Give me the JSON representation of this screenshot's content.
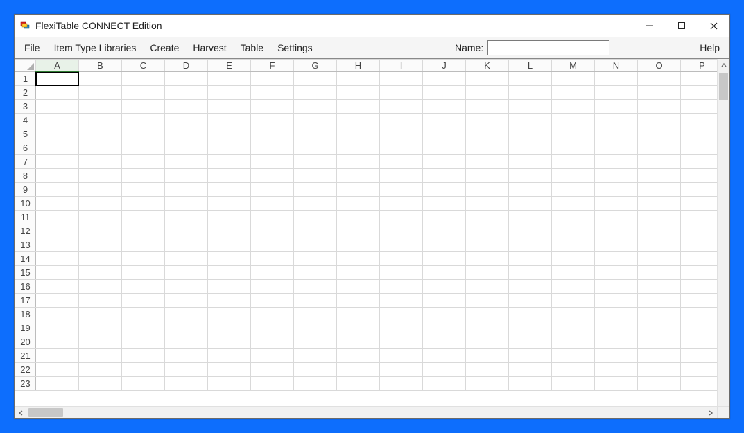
{
  "window": {
    "title": "FlexiTable CONNECT Edition"
  },
  "menubar": {
    "items": [
      "File",
      "Item Type Libraries",
      "Create",
      "Harvest",
      "Table",
      "Settings"
    ],
    "name_label": "Name:",
    "name_value": "",
    "help": "Help"
  },
  "sheet": {
    "columns": [
      "A",
      "B",
      "C",
      "D",
      "E",
      "F",
      "G",
      "H",
      "I",
      "J",
      "K",
      "L",
      "M",
      "N",
      "O",
      "P"
    ],
    "rows": [
      "1",
      "2",
      "3",
      "4",
      "5",
      "6",
      "7",
      "8",
      "9",
      "10",
      "11",
      "12",
      "13",
      "14",
      "15",
      "16",
      "17",
      "18",
      "19",
      "20",
      "21",
      "22",
      "23"
    ],
    "selected_column": "A",
    "active_cell": {
      "row": "1",
      "col": "A"
    }
  }
}
